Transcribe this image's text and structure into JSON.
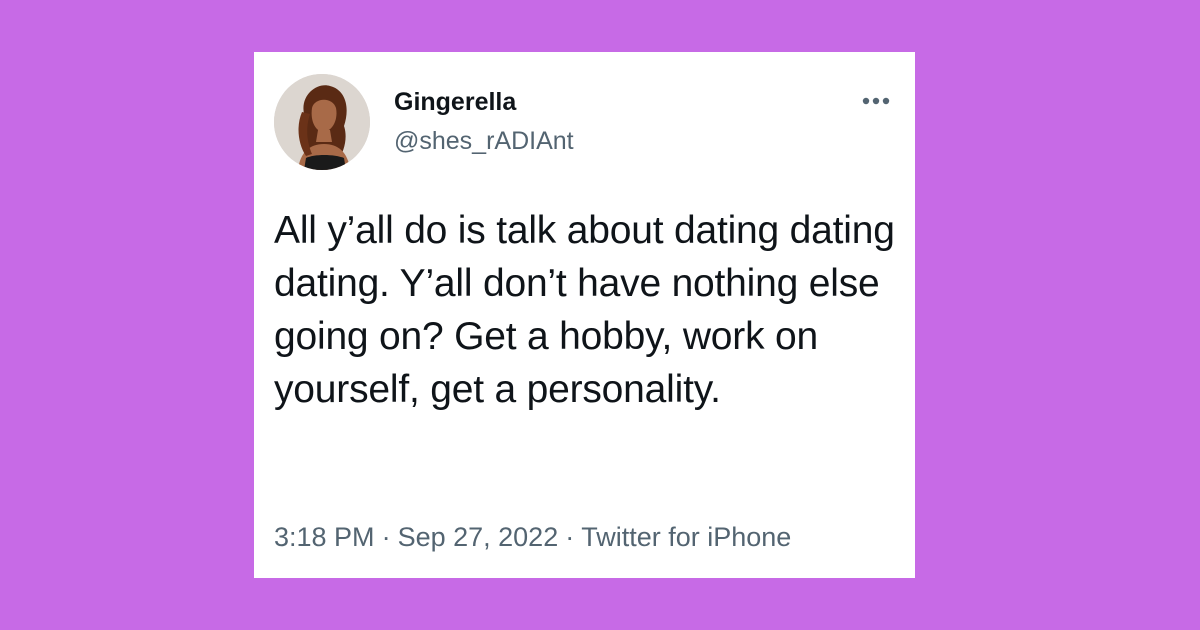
{
  "colors": {
    "background": "#c76ae6",
    "card": "#ffffff",
    "text_primary": "#0f1419",
    "text_secondary": "#536471"
  },
  "tweet": {
    "author": {
      "display_name": "Gingerella",
      "handle": "@shes_rADIAnt",
      "avatar_icon": "profile-photo"
    },
    "more_icon": "more-horizontal-icon",
    "text": "All y’all do is talk about dating dating dating. Y’all don’t have nothing else going on? Get a hobby, work on yourself, get a personality.",
    "time": "3:18 PM",
    "date": "Sep 27, 2022",
    "source": "Twitter for iPhone",
    "separator": "·"
  }
}
